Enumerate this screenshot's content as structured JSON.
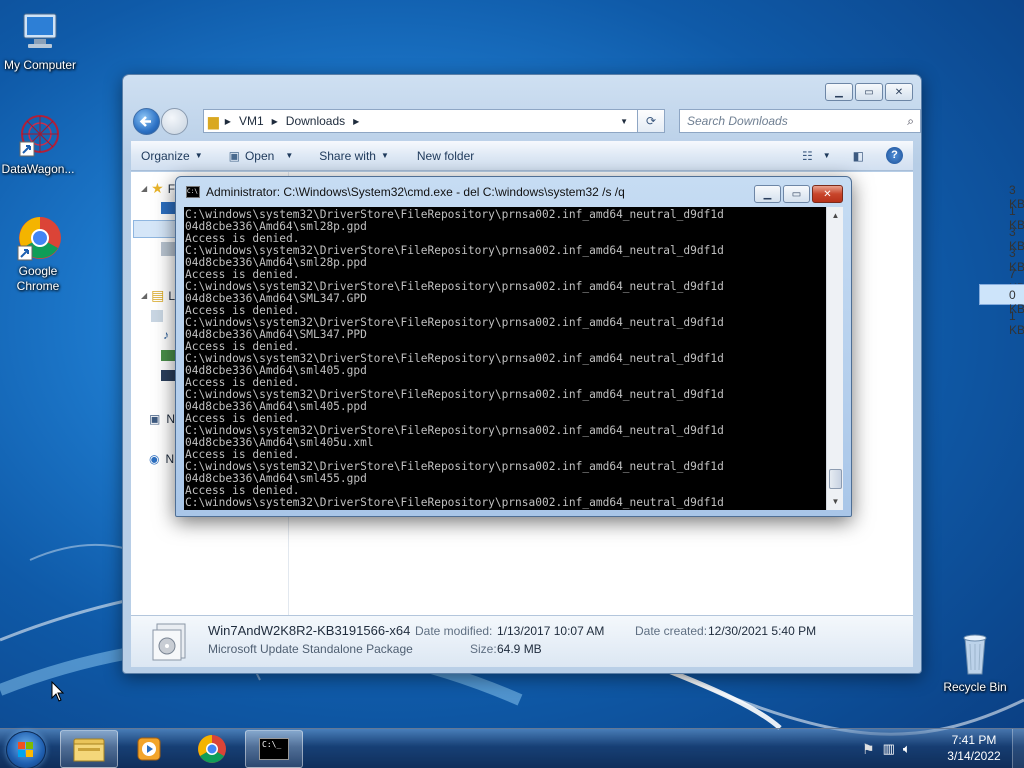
{
  "desktop": {
    "icons": [
      {
        "label": "My Computer"
      },
      {
        "label": "DataWagon..."
      },
      {
        "label": "Google Chrome"
      },
      {
        "label": "Recycle Bin"
      }
    ]
  },
  "explorer": {
    "address": {
      "crumbs": [
        "VM1",
        "Downloads"
      ]
    },
    "search": {
      "placeholder": "Search Downloads"
    },
    "toolbar": {
      "organize": "Organize",
      "open": "Open",
      "share_with": "Share with",
      "new_folder": "New folder"
    },
    "file_sizes_visible": [
      "3 KB",
      "1 KB",
      "3 KB",
      "3 KB",
      "7 KB",
      "0 KB",
      "1 KB"
    ],
    "nav_fragments": [
      "F",
      "L",
      "N",
      "N"
    ],
    "details": {
      "name": "Win7AndW2K8R2-KB3191566-x64",
      "type": "Microsoft Update Standalone Package",
      "date_modified_label": "Date modified:",
      "date_modified": "1/13/2017 10:07 AM",
      "date_created_label": "Date created:",
      "date_created": "12/30/2021 5:40 PM",
      "size_label": "Size:",
      "size": "64.9 MB"
    }
  },
  "cmd": {
    "title": "Administrator: C:\\Windows\\System32\\cmd.exe - del  C:\\windows\\system32 /s /q",
    "icon_text": "C:\\",
    "lines": [
      "C:\\windows\\system32\\DriverStore\\FileRepository\\prnsa002.inf_amd64_neutral_d9df1d",
      "04d8cbe336\\Amd64\\sml28p.gpd",
      "Access is denied.",
      "C:\\windows\\system32\\DriverStore\\FileRepository\\prnsa002.inf_amd64_neutral_d9df1d",
      "04d8cbe336\\Amd64\\sml28p.ppd",
      "Access is denied.",
      "C:\\windows\\system32\\DriverStore\\FileRepository\\prnsa002.inf_amd64_neutral_d9df1d",
      "04d8cbe336\\Amd64\\SML347.GPD",
      "Access is denied.",
      "C:\\windows\\system32\\DriverStore\\FileRepository\\prnsa002.inf_amd64_neutral_d9df1d",
      "04d8cbe336\\Amd64\\SML347.PPD",
      "Access is denied.",
      "C:\\windows\\system32\\DriverStore\\FileRepository\\prnsa002.inf_amd64_neutral_d9df1d",
      "04d8cbe336\\Amd64\\sml405.gpd",
      "Access is denied.",
      "C:\\windows\\system32\\DriverStore\\FileRepository\\prnsa002.inf_amd64_neutral_d9df1d",
      "04d8cbe336\\Amd64\\sml405.ppd",
      "Access is denied.",
      "C:\\windows\\system32\\DriverStore\\FileRepository\\prnsa002.inf_amd64_neutral_d9df1d",
      "04d8cbe336\\Amd64\\sml405u.xml",
      "Access is denied.",
      "C:\\windows\\system32\\DriverStore\\FileRepository\\prnsa002.inf_amd64_neutral_d9df1d",
      "04d8cbe336\\Amd64\\sml455.gpd",
      "Access is denied.",
      "C:\\windows\\system32\\DriverStore\\FileRepository\\prnsa002.inf_amd64_neutral_d9df1d"
    ]
  },
  "taskbar": {
    "cmd_icon_text": "C:\\_",
    "clock": {
      "time": "7:41 PM",
      "date": "3/14/2022"
    }
  },
  "colors": {
    "console_bg": "#000000",
    "console_fg": "#c0c0c0",
    "close_red": "#c8452b"
  }
}
